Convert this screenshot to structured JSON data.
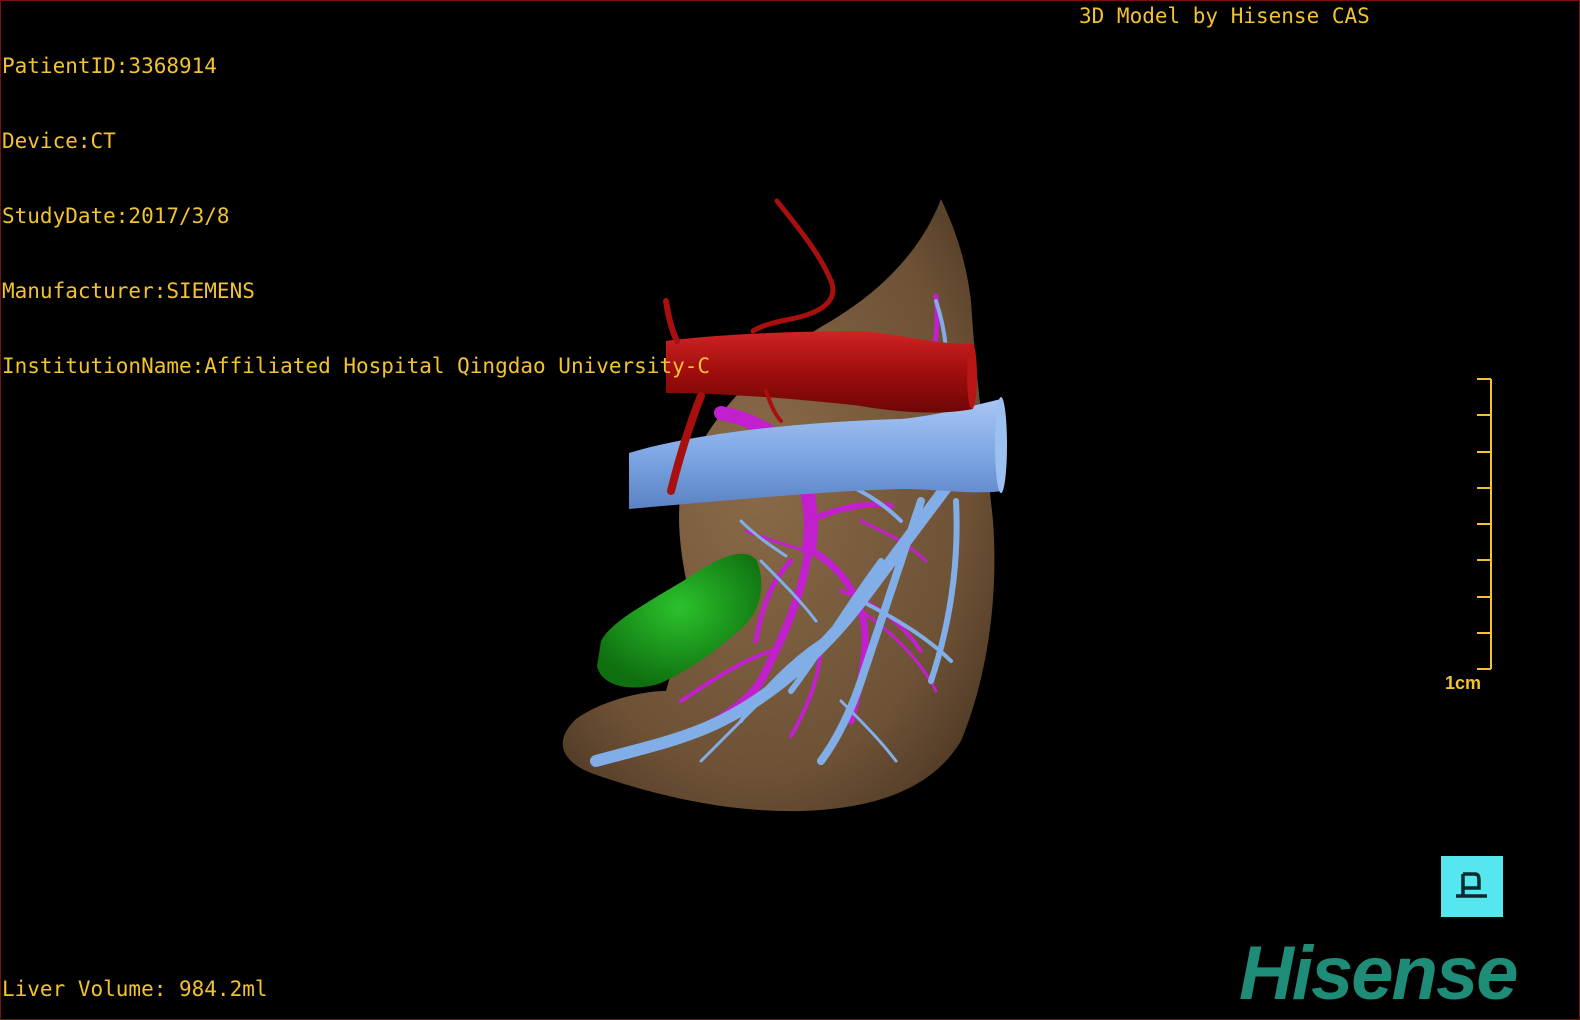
{
  "patient_info": {
    "patient_id": "PatientID:3368914",
    "device": "Device:CT",
    "study_date": "StudyDate:2017/3/8",
    "manufacturer": "Manufacturer:SIEMENS",
    "institution": "InstitutionName:Affiliated Hospital Qingdao University-C"
  },
  "model_credit": "3D Model by Hisense CAS",
  "liver_volume": "Liver Volume: 984.2ml",
  "scale_bar": {
    "label": "1cm"
  },
  "orientation_button": {
    "icon": "posterior-view-icon"
  },
  "logo": {
    "text": "Hisense",
    "color": "#1f8c78"
  },
  "colors": {
    "text": "#f2c230",
    "liver": "#7a5c3c",
    "aorta": "#b01010",
    "inferior_vena_cava": "#7fa8e6",
    "portal_vein": "#c020d0",
    "gallbladder": "#1a9c1a",
    "orientation_button": "#55e6ef"
  }
}
